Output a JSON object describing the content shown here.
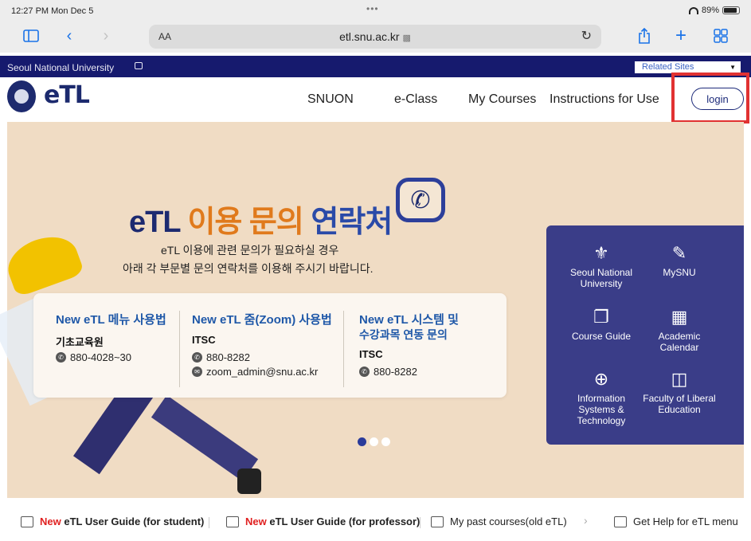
{
  "status": {
    "time": "12:27 PM  Mon Dec 5",
    "dots": "•••",
    "battery": "89%"
  },
  "browser": {
    "aa_label": "AA",
    "url": "etl.snu.ac.kr",
    "lock_icon": "lock-icon"
  },
  "univbar": {
    "name": "Seoul National University",
    "related": "Related Sites"
  },
  "header": {
    "logo_text": "eTL",
    "nav": [
      "SNUON",
      "e-Class",
      "My Courses",
      "Instructions for Use"
    ],
    "login": "login"
  },
  "hero": {
    "title_1": "eTL",
    "title_2": "이용",
    "title_3": "문의",
    "title_4": "연락처",
    "sub1": "eTL 이용에 관련 문의가 필요하실 경우",
    "sub2": "아래 각 부문별 문의 연락처를 이용해 주시기 바랍니다.",
    "cards": [
      {
        "title": "New eTL 메뉴 사용법",
        "org": "기초교육원",
        "phone": "880-4028~30"
      },
      {
        "title": "New eTL 줌(Zoom) 사용법",
        "org": "ITSC",
        "phone": "880-8282",
        "email": "zoom_admin@snu.ac.kr"
      },
      {
        "title": "New eTL 시스템 및",
        "title2": "수강과목 연동 문의",
        "org": "ITSC",
        "phone": "880-8282"
      }
    ]
  },
  "quicklinks": [
    {
      "label": "Seoul National University",
      "icon": "snu-seal-icon"
    },
    {
      "label": "MySNU",
      "icon": "user-edit-icon"
    },
    {
      "label": "Course Guide",
      "icon": "book-icon"
    },
    {
      "label": "Academic Calendar",
      "icon": "calendar-icon"
    },
    {
      "label": "Information Systems & Technology",
      "icon": "globe-user-icon"
    },
    {
      "label": "Faculty of Liberal Education",
      "icon": "book-open-icon"
    }
  ],
  "slider": {
    "count": 3,
    "active": 0
  },
  "bottom_links": [
    {
      "new": "New",
      "label": "eTL User Guide (for student)"
    },
    {
      "new": "New",
      "label": "eTL User Guide (for professor)"
    },
    {
      "label": "My past courses(old eTL)"
    },
    {
      "label": "Get Help for eTL menu"
    }
  ],
  "colors": {
    "navy": "#161a6e",
    "accent_red": "#e13232",
    "hero_bg": "#f0dcc4",
    "panel": "#3a3d88"
  }
}
